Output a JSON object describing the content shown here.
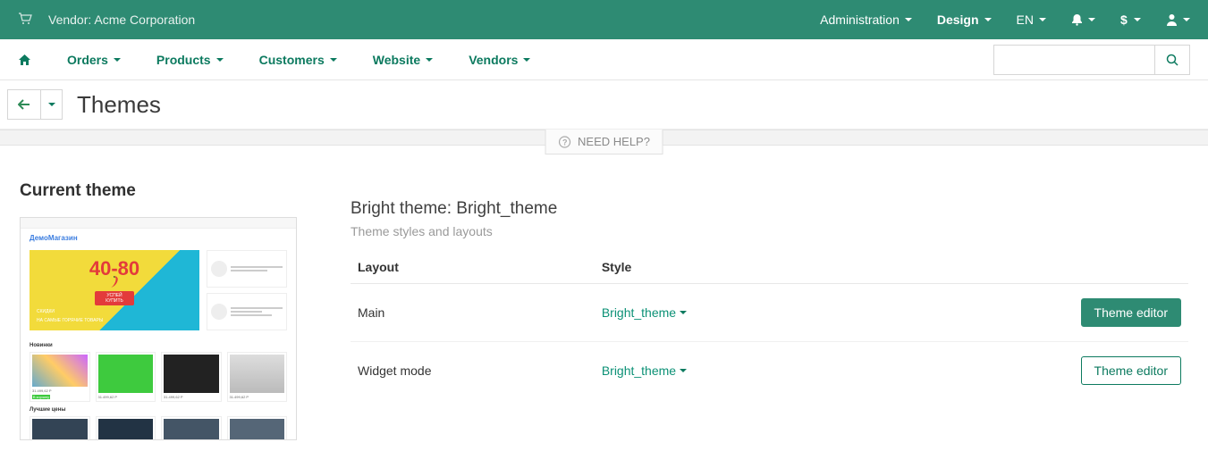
{
  "topbar": {
    "vendor_label": "Vendor: Acme Corporation",
    "links": {
      "administration": "Administration",
      "design": "Design",
      "language": "EN"
    }
  },
  "nav": {
    "orders": "Orders",
    "products": "Products",
    "customers": "Customers",
    "website": "Website",
    "vendors": "Vendors"
  },
  "page": {
    "title": "Themes",
    "help": "NEED HELP?"
  },
  "current": {
    "heading": "Current theme",
    "theme_title": "Bright theme: Bright_theme",
    "theme_sub": "Theme styles and layouts",
    "columns": {
      "layout": "Layout",
      "style": "Style"
    },
    "rows": [
      {
        "layout": "Main",
        "style": "Bright_theme",
        "editor_label": "Theme editor",
        "primary": true
      },
      {
        "layout": "Widget mode",
        "style": "Bright_theme",
        "editor_label": "Theme editor",
        "primary": false
      }
    ]
  },
  "thumb": {
    "logo": "ДемоМагазин",
    "banner_big": "40-80",
    "banner_cta": "УСПЕЙ КУПИТЬ",
    "banner_sub1": "СКИДКИ",
    "banner_sub2": "НА САМЫЕ ГОРЯЧИЕ ТОВАРЫ",
    "section1": "Новинки",
    "section2": "Лучшие цены"
  }
}
